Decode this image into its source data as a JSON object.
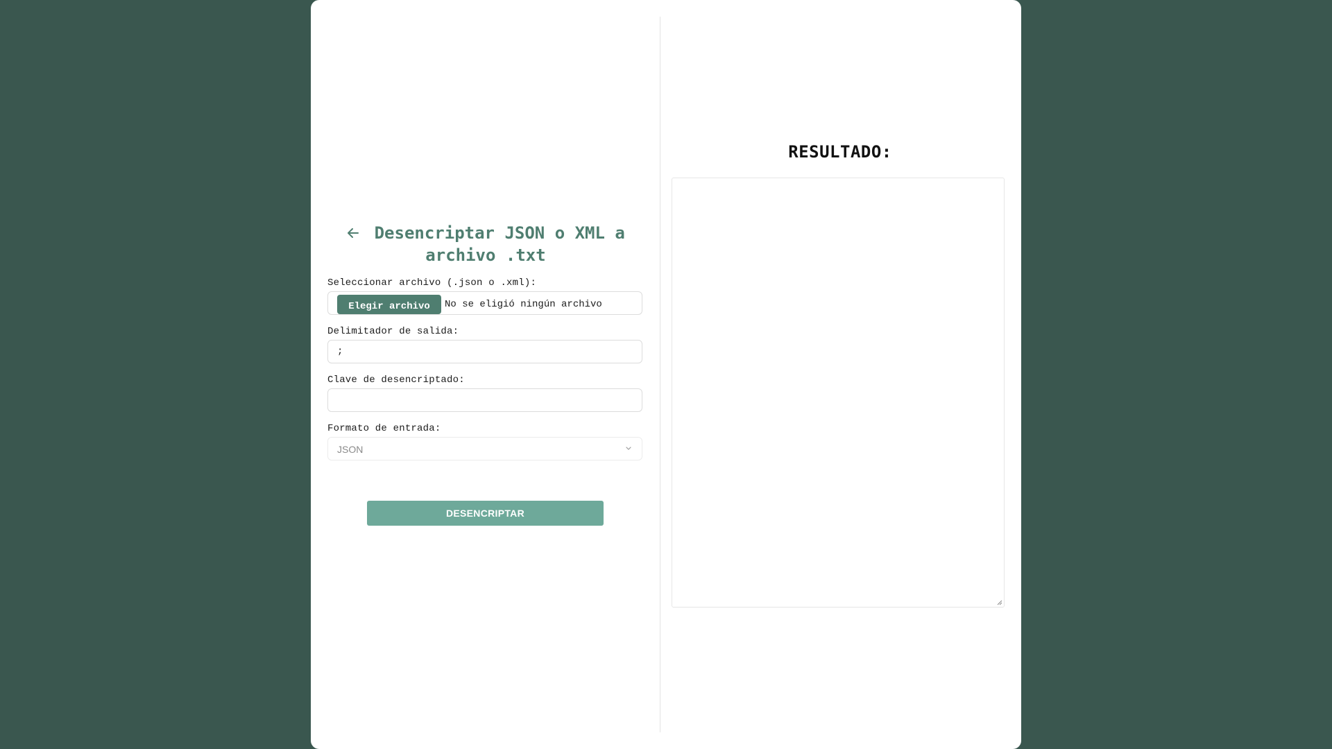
{
  "page": {
    "title_line1": "Desencriptar JSON o XML a",
    "title_line2": "archivo .txt",
    "back_icon": "arrow-left-icon"
  },
  "form": {
    "file_label": "Seleccionar archivo (.json o .xml):",
    "file_button": "Elegir archivo",
    "file_status": "No se eligió ningún archivo",
    "delimiter_label": "Delimitador de salida:",
    "delimiter_value": ";",
    "key_label": "Clave de desencriptado:",
    "key_value": "",
    "format_label": "Formato de entrada:",
    "format_selected": "JSON",
    "submit_label": "DESENCRIPTAR"
  },
  "result": {
    "title": "RESULTADO:",
    "value": ""
  },
  "colors": {
    "background": "#3a574f",
    "accent": "#4f7e70",
    "button": "#6ea99a"
  }
}
